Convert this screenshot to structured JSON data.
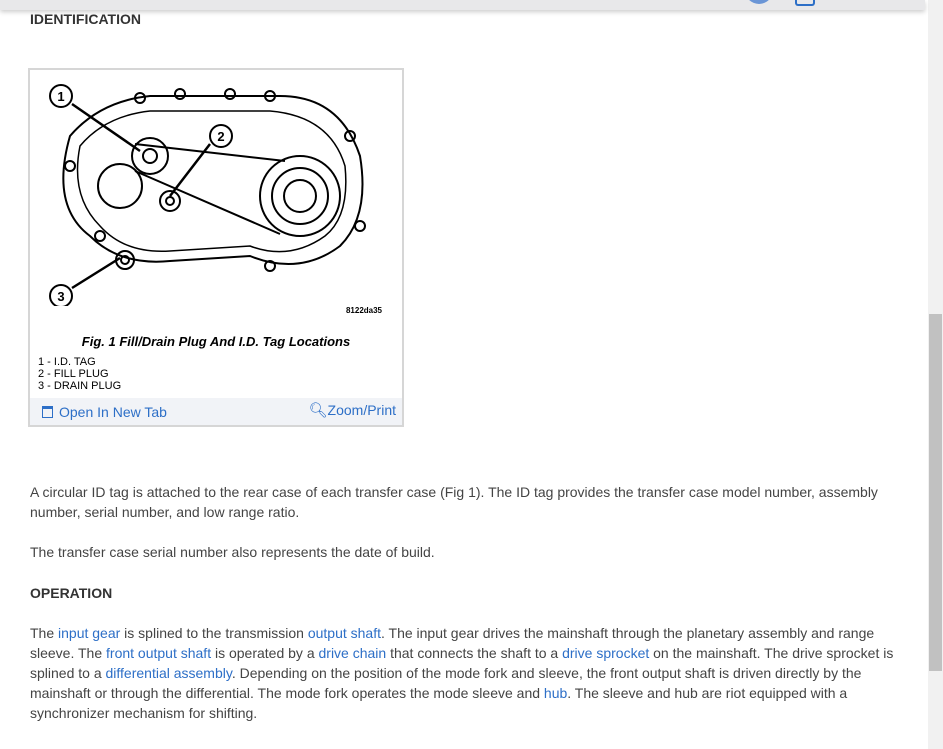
{
  "sections": {
    "identification": "IDENTIFICATION",
    "operation": "OPERATION"
  },
  "figure": {
    "code": "8122da35",
    "caption": "Fig. 1 Fill/Drain Plug And I.D. Tag Locations",
    "legend": [
      "1 - I.D. TAG",
      "2 - FILL PLUG",
      "3 - DRAIN PLUG"
    ],
    "callouts": [
      "1",
      "2",
      "3"
    ],
    "open_label": "Open In New Tab",
    "zoom_label": "Zoom/Print"
  },
  "paragraphs": {
    "p1": " A circular ID tag is attached to the rear case of each transfer case (Fig 1). The ID tag provides the transfer case model number, assembly number, serial number, and low range ratio.",
    "p2": " The transfer case serial number also represents the date of build."
  },
  "operation": {
    "t1": " The ",
    "l1": "input gear",
    "t2": " is splined to the transmission ",
    "l2": "output shaft",
    "t3": ". The input gear drives the mainshaft through the planetary assembly and range sleeve. The ",
    "l3": "front output shaft",
    "t4": " is operated by a ",
    "l4": "drive chain",
    "t5": " that connects the shaft to a ",
    "l5": "drive sprocket",
    "t6": " on the mainshaft. The drive sprocket is splined to a ",
    "l6": "differential assembly",
    "t7": ". Depending on the position of the mode fork and sleeve, the front output shaft is driven directly by the mainshaft or through the differential. The mode fork operates the mode sleeve and ",
    "l7": "hub",
    "t8": ". The sleeve and hub are riot equipped with a synchronizer mechanism for shifting."
  },
  "colors": {
    "link": "#2d6fc7",
    "scroll_thumb": "#c1c1c1"
  }
}
